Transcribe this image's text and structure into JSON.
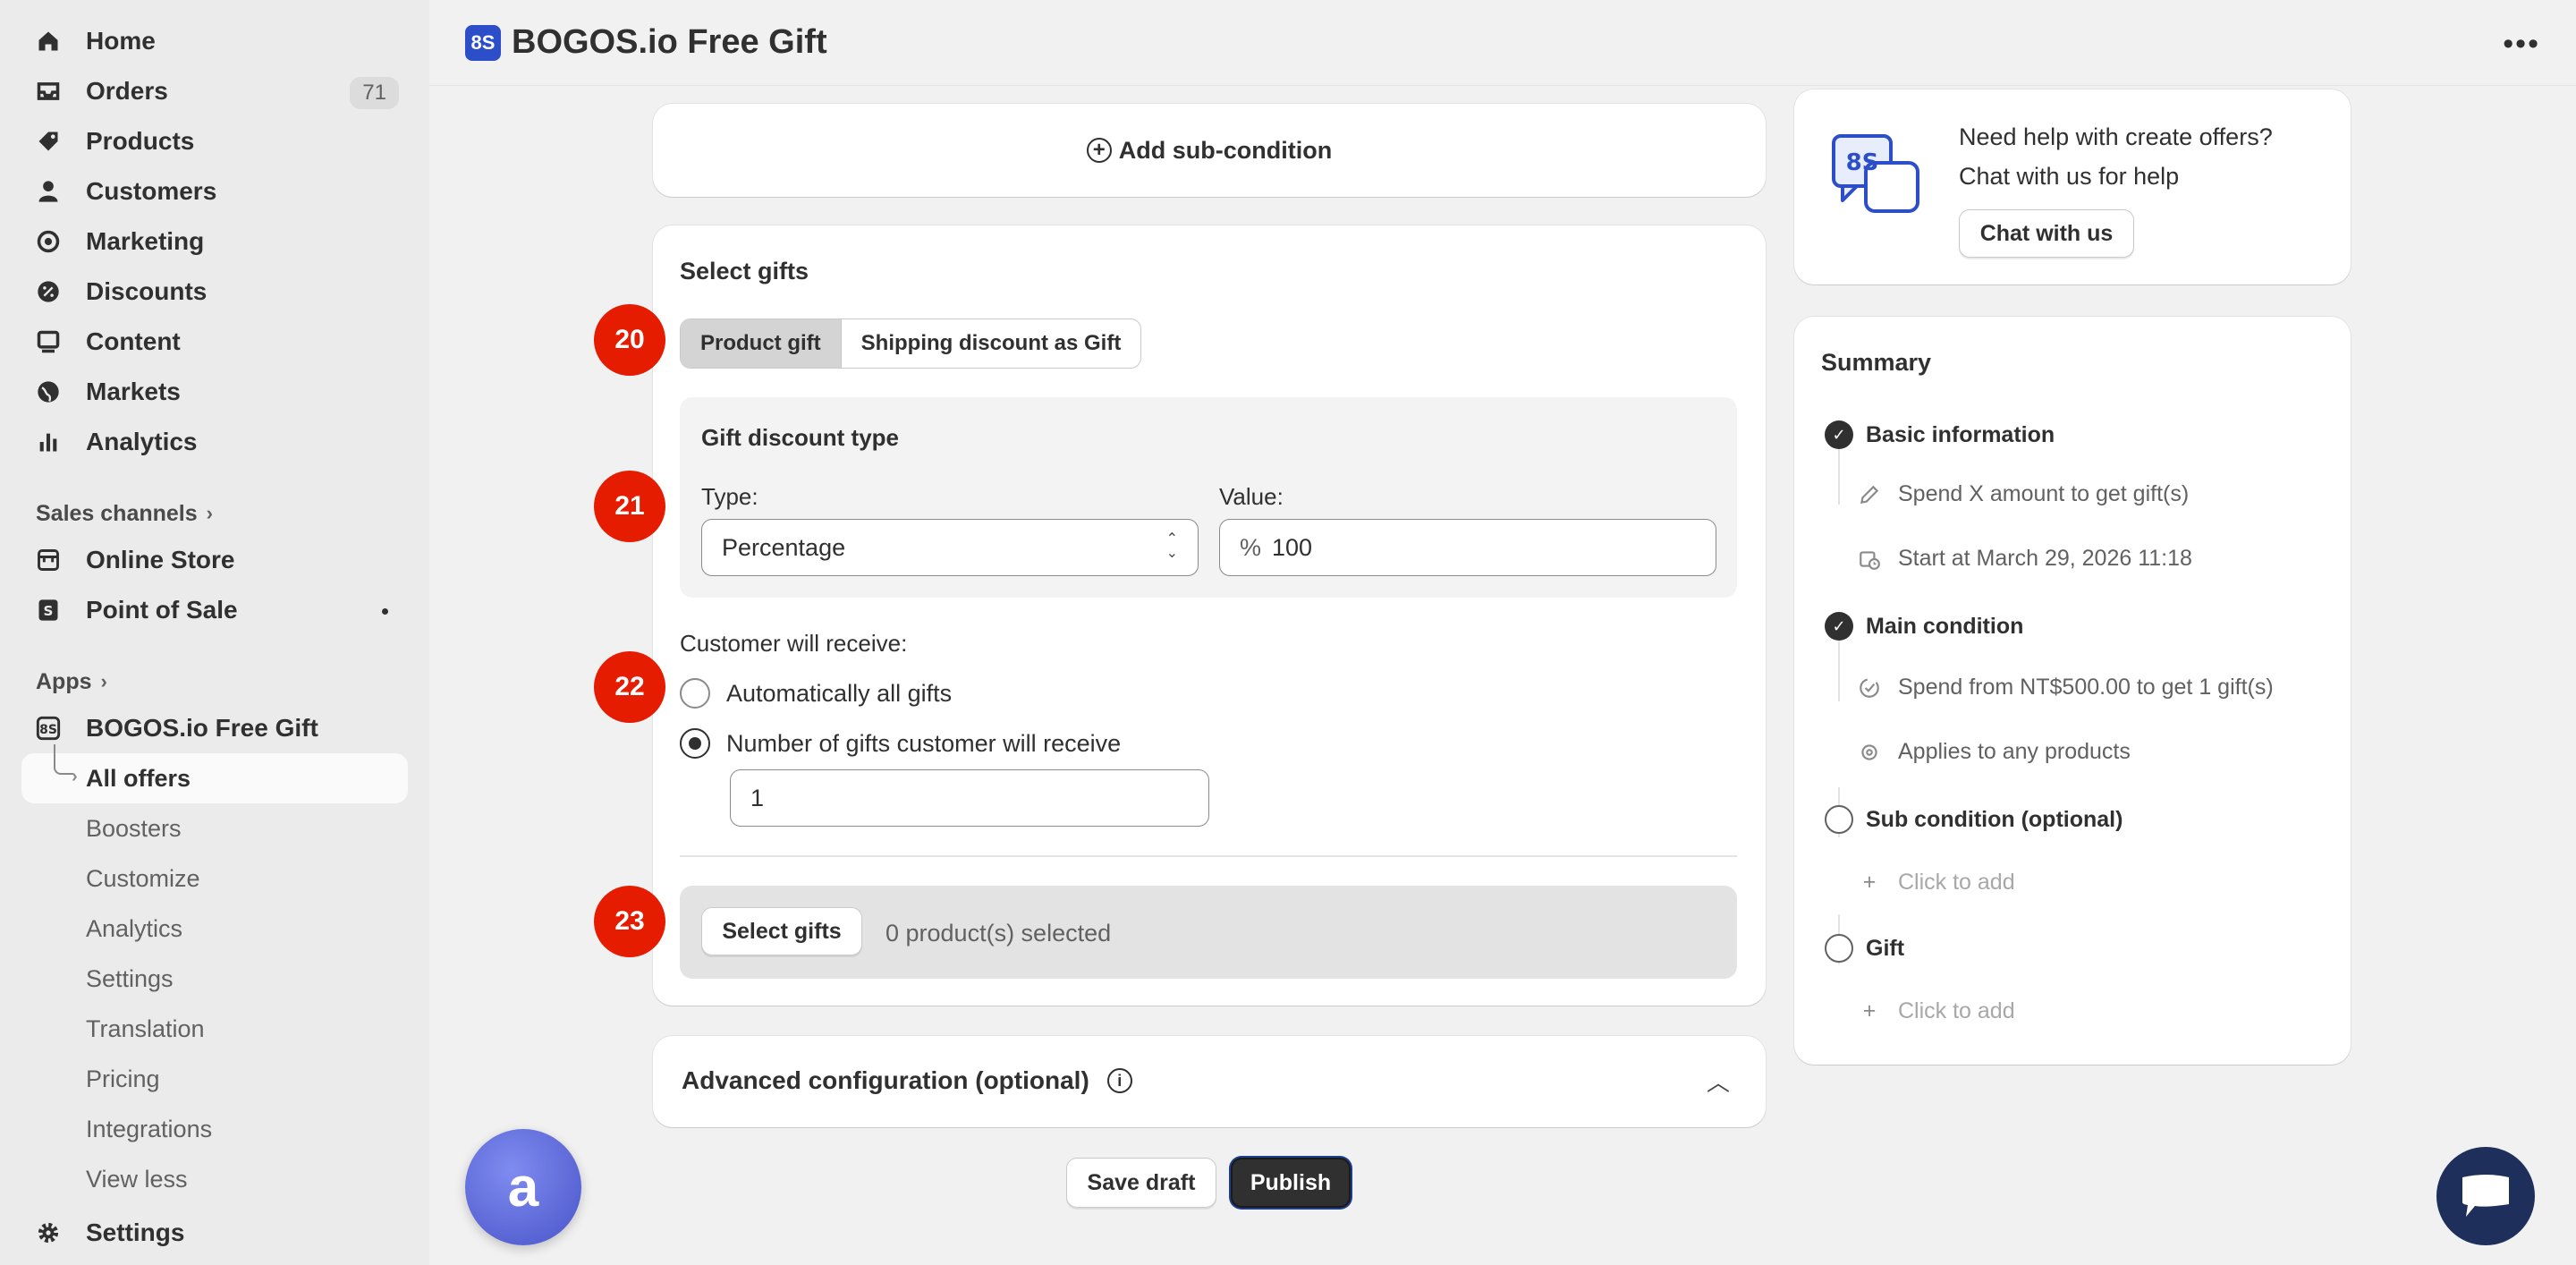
{
  "sidebar": {
    "nav": [
      {
        "label": "Home",
        "icon": "home-icon"
      },
      {
        "label": "Orders",
        "icon": "inbox-icon",
        "badge": "71"
      },
      {
        "label": "Products",
        "icon": "tag-icon"
      },
      {
        "label": "Customers",
        "icon": "person-icon"
      },
      {
        "label": "Marketing",
        "icon": "target-icon"
      },
      {
        "label": "Discounts",
        "icon": "discount-icon"
      },
      {
        "label": "Content",
        "icon": "content-icon"
      },
      {
        "label": "Markets",
        "icon": "globe-icon"
      },
      {
        "label": "Analytics",
        "icon": "bar-chart-icon"
      }
    ],
    "sales_channels_label": "Sales channels",
    "channels": [
      {
        "label": "Online Store",
        "icon": "store-icon"
      },
      {
        "label": "Point of Sale",
        "icon": "pos-icon"
      }
    ],
    "apps_label": "Apps",
    "app_name": "BOGOS.io Free Gift",
    "app_sub": [
      "All offers",
      "Boosters",
      "Customize",
      "Analytics",
      "Settings",
      "Translation",
      "Pricing",
      "Integrations",
      "View less"
    ],
    "settings_label": "Settings"
  },
  "topbar": {
    "title": "BOGOS.io Free Gift",
    "logo_text": "8S",
    "more": "•••"
  },
  "main": {
    "add_sub_condition": "Add sub-condition",
    "select_gifts_title": "Select gifts",
    "gift_tabs": [
      "Product gift",
      "Shipping discount as Gift"
    ],
    "gift_discount_type_title": "Gift discount type",
    "type_label": "Type:",
    "type_value": "Percentage",
    "value_label": "Value:",
    "value_prefix": "%",
    "value_value": "100",
    "receive_label": "Customer will receive:",
    "receive_options": [
      "Automatically all gifts",
      "Number of gifts customer will receive"
    ],
    "gift_count": "1",
    "select_gifts_button": "Select gifts",
    "selected_count": "0 product(s) selected",
    "advanced_title": "Advanced configuration (optional)",
    "save_draft": "Save draft",
    "publish": "Publish",
    "markers": [
      "20",
      "21",
      "22",
      "23"
    ]
  },
  "help": {
    "line1": "Need help with create offers?",
    "line2": "Chat with us for help",
    "button": "Chat with us"
  },
  "summary": {
    "title": "Summary",
    "basic": "Basic information",
    "basic_items": [
      "Spend X amount to get gift(s)",
      "Start at March 29, 2026 11:18"
    ],
    "main": "Main condition",
    "main_items": [
      "Spend from NT$500.00 to get 1 gift(s)",
      "Applies to any products"
    ],
    "sub": "Sub condition (optional)",
    "sub_item": "Click to add",
    "gift": "Gift",
    "gift_item": "Click to add"
  },
  "floating": {
    "avatar_text": "a"
  },
  "colors": {
    "marker": "#e51c00",
    "brand": "#2c4ec9",
    "chat": "#1d2f5a"
  }
}
